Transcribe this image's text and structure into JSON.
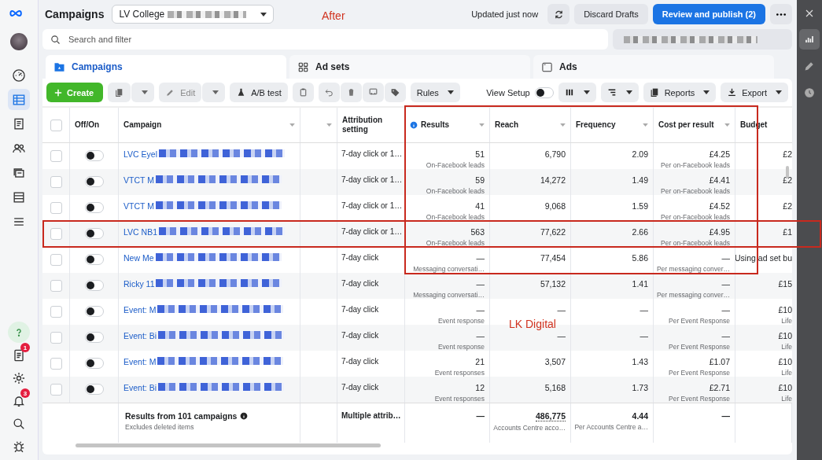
{
  "left_nav": {
    "items": [
      {
        "selected": false
      },
      {
        "selected": true
      },
      {
        "selected": false
      },
      {
        "selected": false
      },
      {
        "selected": false
      },
      {
        "selected": false
      },
      {
        "selected": false
      }
    ],
    "notification_badges": [
      "1",
      "3"
    ]
  },
  "header": {
    "title": "Campaigns",
    "account": "LV College",
    "updated": "Updated just now",
    "discard": "Discard Drafts",
    "publish": "Review and publish (2)"
  },
  "search": {
    "placeholder": "Search and filter"
  },
  "tabs": [
    {
      "label": "Campaigns",
      "selected": true
    },
    {
      "label": "Ad sets",
      "selected": false
    },
    {
      "label": "Ads",
      "selected": false
    }
  ],
  "toolbar": {
    "create": "Create",
    "edit": {
      "label": "Edit",
      "disabled": true
    },
    "ab_test": "A/B test",
    "rules": "Rules",
    "view_setup": {
      "label": "View Setup",
      "on": false
    },
    "reports": "Reports",
    "export": "Export"
  },
  "table": {
    "header_checkbox": {
      "checked": false
    },
    "columns": [
      {
        "label": "Off/On",
        "menu": false
      },
      {
        "label": "Campaign",
        "menu": true
      },
      {
        "menu": true
      },
      {
        "label": "Attribution setting",
        "menu": false
      },
      {
        "label": "Results",
        "menu": true,
        "info": true
      },
      {
        "label": "Reach",
        "menu": true
      },
      {
        "label": "Frequency",
        "menu": true
      },
      {
        "label": "Cost per result",
        "menu": true
      },
      {
        "label": "Budget",
        "menu": false
      }
    ],
    "rows": [
      {
        "checked": false,
        "on": false,
        "name": "LVC Eyel",
        "attribution": "7-day click or 1…",
        "results": "51",
        "results_sub": "On-Facebook leads",
        "reach": "6,790",
        "frequency": "2.09",
        "cost": "£4.25",
        "cost_sub": "Per on-Facebook leads",
        "budget": "£2",
        "highlighted": false,
        "boxed": true
      },
      {
        "checked": false,
        "on": false,
        "name": "VTCT M",
        "attribution": "7-day click or 1…",
        "results": "59",
        "results_sub": "On-Facebook leads",
        "reach": "14,272",
        "frequency": "1.49",
        "cost": "£4.41",
        "cost_sub": "Per on-Facebook leads",
        "budget": "£2",
        "highlighted": false,
        "boxed": true
      },
      {
        "checked": false,
        "on": false,
        "name": "VTCT M",
        "attribution": "7-day click or 1…",
        "results": "41",
        "results_sub": "On-Facebook leads",
        "reach": "9,068",
        "frequency": "1.59",
        "cost": "£4.52",
        "cost_sub": "Per on-Facebook leads",
        "budget": "£2",
        "highlighted": false,
        "boxed": true
      },
      {
        "checked": false,
        "on": false,
        "name": "LVC NB1",
        "attribution": "7-day click or 1…",
        "results": "563",
        "results_sub": "On-Facebook leads",
        "reach": "77,622",
        "frequency": "2.66",
        "cost": "£4.95",
        "cost_sub": "Per on-Facebook leads",
        "budget": "£1",
        "highlighted": true,
        "boxed": true
      },
      {
        "checked": false,
        "on": false,
        "name": "New Me",
        "attribution": "7-day click",
        "results": "—",
        "results_sub": "Messaging conversati…",
        "reach": "77,454",
        "frequency": "5.86",
        "cost": "—",
        "cost_sub": "Per messaging conver…",
        "budget": "Using ad set bu",
        "highlighted": false,
        "boxed": true
      },
      {
        "checked": false,
        "on": false,
        "name": "Ricky 11",
        "attribution": "7-day click",
        "results": "—",
        "results_sub": "Messaging conversati…",
        "reach": "57,132",
        "frequency": "1.41",
        "cost": "—",
        "cost_sub": "Per messaging conver…",
        "budget": "£15",
        "highlighted": false,
        "boxed": false
      },
      {
        "checked": false,
        "on": false,
        "name": "Event: M",
        "attribution": "7-day click",
        "results": "—",
        "results_sub": "Event response",
        "reach": "—",
        "frequency": "—",
        "cost": "—",
        "cost_sub": "Per Event Response",
        "budget": "£10",
        "budget_sub": "Life",
        "highlighted": false,
        "boxed": false
      },
      {
        "checked": false,
        "on": false,
        "name": "Event: Bi",
        "attribution": "7-day click",
        "results": "—",
        "results_sub": "Event response",
        "reach": "—",
        "frequency": "—",
        "cost": "—",
        "cost_sub": "Per Event Response",
        "budget": "£10",
        "budget_sub": "Life",
        "highlighted": false,
        "boxed": false
      },
      {
        "checked": false,
        "on": false,
        "name": "Event: M",
        "attribution": "7-day click",
        "results": "21",
        "results_sub": "Event responses",
        "reach": "3,507",
        "frequency": "1.43",
        "cost": "£1.07",
        "cost_sub": "Per Event Response",
        "budget": "£10",
        "budget_sub": "Life",
        "highlighted": false,
        "boxed": false
      },
      {
        "checked": false,
        "on": false,
        "name": "Event: Bi",
        "attribution": "7-day click",
        "results": "12",
        "results_sub": "Event responses",
        "reach": "5,168",
        "frequency": "1.73",
        "cost": "£2.71",
        "cost_sub": "Per Event Response",
        "budget": "£10",
        "budget_sub": "Life",
        "highlighted": false,
        "boxed": false
      }
    ],
    "footer": {
      "title": "Results from 101 campaigns",
      "note": "Excludes deleted items",
      "attribution": "Multiple attrib…",
      "results": "—",
      "reach": "486,775",
      "reach_sub": "Accounts Centre acco…",
      "frequency": "4.44",
      "frequency_sub": "Per Accounts Centre a…",
      "cost": "—"
    }
  },
  "right_bar": {
    "items": [
      {
        "selected": true
      },
      {
        "selected": false
      },
      {
        "selected": false
      }
    ]
  },
  "annotations": [
    "After",
    "LK Digital"
  ]
}
